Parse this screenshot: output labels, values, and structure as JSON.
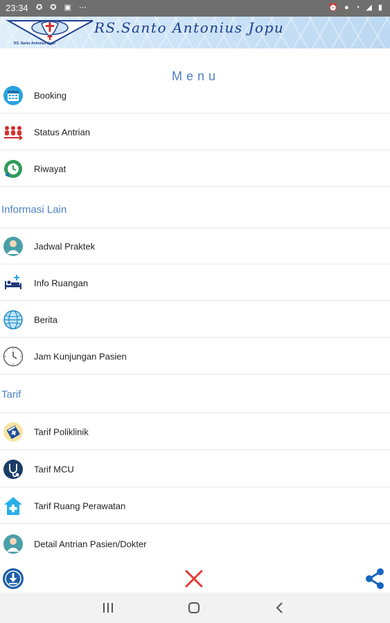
{
  "status_bar": {
    "time": "23:34"
  },
  "header": {
    "name": "RS.Santo Antonius Jopu",
    "logo_caption": "RS. Santo Antonius Jopu"
  },
  "menu_title": "Menu",
  "menu_items": [
    {
      "label": "Booking",
      "icon": "calendar-icon"
    },
    {
      "label": "Status Antrian",
      "icon": "queue-icon"
    },
    {
      "label": "Riwayat",
      "icon": "history-icon"
    }
  ],
  "sections": {
    "informasi_lain": "Informasi Lain",
    "tarif": "Tarif"
  },
  "info_items": [
    {
      "label": "Jadwal Praktek",
      "icon": "doctor-icon"
    },
    {
      "label": "Info Ruangan",
      "icon": "hospital-bed-icon"
    },
    {
      "label": "Berita",
      "icon": "globe-icon"
    },
    {
      "label": "Jam Kunjungan Pasien",
      "icon": "clock-icon"
    }
  ],
  "tarif_items": [
    {
      "label": "Tarif Poliklinik",
      "icon": "medical-book-icon"
    },
    {
      "label": "Tarif MCU",
      "icon": "stethoscope-icon"
    },
    {
      "label": "Tarif Ruang Perawatan",
      "icon": "hospital-icon"
    },
    {
      "label": "Detail Antrian Pasien/Dokter",
      "icon": "doctor-icon"
    }
  ],
  "colors": {
    "accent": "#4d7fc4",
    "header_text": "#1c3f8f",
    "close_red": "#e53935",
    "share_blue": "#1565c0"
  }
}
